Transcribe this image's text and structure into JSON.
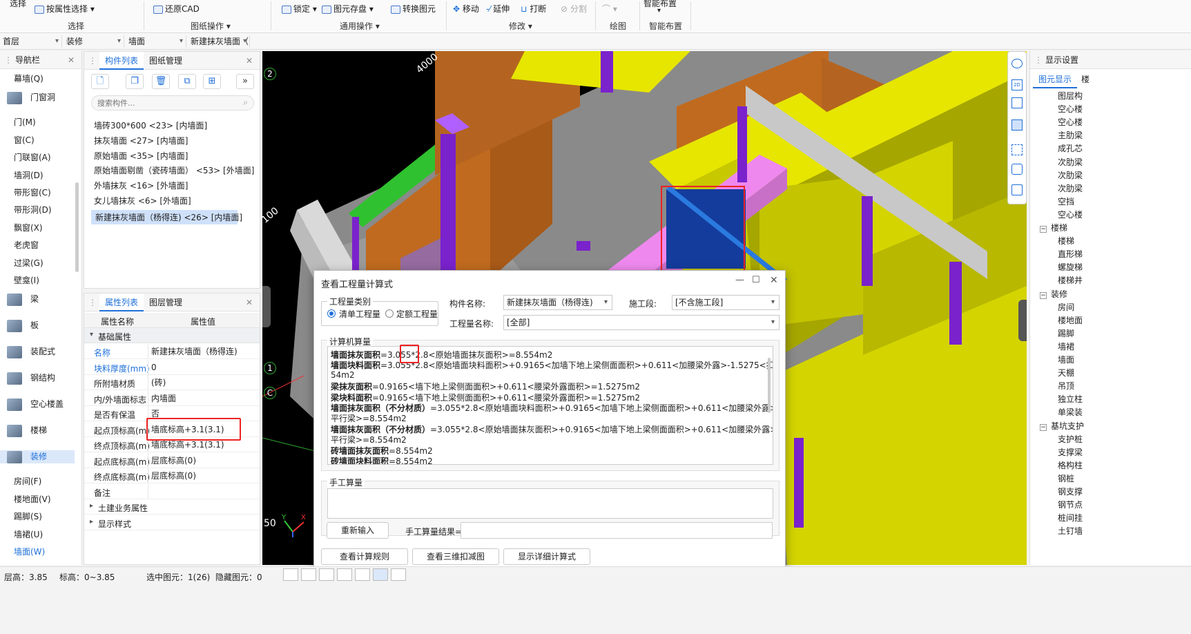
{
  "ribbon": {
    "select_label": "选择",
    "attr_select": "按属性选择",
    "select_group": "选择",
    "restore_cad": "还原CAD",
    "drawing_ops": "图纸操作",
    "lock": "锁定",
    "elem_save": "图元存盘",
    "convert_elem": "转换图元",
    "common_ops": "通用操作",
    "move": "移动",
    "extend": "延伸",
    "break": "打断",
    "split": "分割",
    "modify": "修改",
    "draw": "绘图",
    "smart_layout_top": "智能布置",
    "smart_layout": "智能布置"
  },
  "selectors": [
    "首层",
    "装修",
    "墙面",
    "新建抹灰墙面（"
  ],
  "nav": {
    "title": "导航栏",
    "items": [
      {
        "label": "幕墙(Q)",
        "type": "small"
      },
      {
        "label": "门窗洞",
        "type": "big"
      },
      {
        "label": "门(M)",
        "type": "small"
      },
      {
        "label": "窗(C)",
        "type": "small"
      },
      {
        "label": "门联窗(A)",
        "type": "small"
      },
      {
        "label": "墙洞(D)",
        "type": "small"
      },
      {
        "label": "带形窗(C)",
        "type": "small"
      },
      {
        "label": "带形洞(D)",
        "type": "small"
      },
      {
        "label": "飘窗(X)",
        "type": "small"
      },
      {
        "label": "老虎窗",
        "type": "small"
      },
      {
        "label": "过梁(G)",
        "type": "small"
      },
      {
        "label": "壁龛(I)",
        "type": "small"
      },
      {
        "label": "梁",
        "type": "big"
      },
      {
        "label": "板",
        "type": "big"
      },
      {
        "label": "装配式",
        "type": "big"
      },
      {
        "label": "钢结构",
        "type": "big"
      },
      {
        "label": "空心楼盖",
        "type": "big"
      },
      {
        "label": "楼梯",
        "type": "big"
      },
      {
        "label": "装修",
        "type": "big"
      },
      {
        "label": "房间(F)",
        "type": "small"
      },
      {
        "label": "楼地面(V)",
        "type": "small"
      },
      {
        "label": "踢脚(S)",
        "type": "small"
      },
      {
        "label": "墙裙(U)",
        "type": "small"
      },
      {
        "label": "墙面(W)",
        "type": "small"
      }
    ]
  },
  "complist": {
    "tab_active": "构件列表",
    "tab_other": "图纸管理",
    "search_placeholder": "搜索构件...",
    "items": [
      "墙砖300*600 <23> [内墙面]",
      "抹灰墙面 <27> [内墙面]",
      "原始墙面 <35> [内墙面]",
      "原始墙面剔凿（瓷砖墙面） <53> [外墙面]",
      "外墙抹灰 <16> [外墙面]",
      "女儿墙抹灰 <6> [外墙面]",
      "新建抹灰墙面（杨得连) <26> [内墙面]"
    ]
  },
  "props": {
    "tab_active": "属性列表",
    "tab_other": "图层管理",
    "col_name": "属性名称",
    "col_value": "属性值",
    "section_basic": "基础属性",
    "rows": [
      {
        "name": "名称",
        "value": "新建抹灰墙面（杨得连)",
        "blue": true
      },
      {
        "name": "块料厚度(mm)",
        "value": "0",
        "blue": true
      },
      {
        "name": "所附墙材质",
        "value": "(砖)",
        "blue": false
      },
      {
        "name": "内/外墙面标志",
        "value": "内墙面",
        "blue": false
      },
      {
        "name": "是否有保温",
        "value": "否",
        "blue": false
      },
      {
        "name": "起点顶标高(m)",
        "value": "墙底标高+3.1(3.1)",
        "blue": false
      },
      {
        "name": "终点顶标高(m)",
        "value": "墙底标高+3.1(3.1)",
        "blue": false
      },
      {
        "name": "起点底标高(m)",
        "value": "层底标高(0)",
        "blue": false
      },
      {
        "name": "终点底标高(m)",
        "value": "层底标高(0)",
        "blue": false
      },
      {
        "name": "备注",
        "value": "",
        "blue": false
      }
    ],
    "section_civil": "土建业务属性",
    "section_display": "显示样式"
  },
  "viewport": {
    "dim_4000": "4000",
    "dim_100": "100",
    "dim_50": "50",
    "axis_2": "2",
    "axis_1": "1",
    "axis_c": "C",
    "triad_y": "Y",
    "triad_x": "X"
  },
  "dialog": {
    "title": "查看工程量计算式",
    "qty_type_label": "工程量类别",
    "radio_bill": "清单工程量",
    "radio_quota": "定额工程量",
    "comp_name_label": "构件名称:",
    "comp_name_value": "新建抹灰墙面（杨得连)",
    "stage_label": "施工段:",
    "stage_value": "[不含施工段]",
    "qty_name_label": "工程量名称:",
    "qty_name_value": "[全部]",
    "calc_label": "计算机算量",
    "formulas": [
      {
        "k": "墙面抹灰面积",
        "v": "=3.055*2.8<原始墙面抹灰面积>=8.554m2"
      },
      {
        "k": "墙面块料面积",
        "v": "=3.055*2.8<原始墙面块料面积>+0.9165<加墙下地上梁侧面面积>+0.611<加腰梁外露>-1.5275<扣平行梁>=8.5"
      },
      {
        "k": "",
        "v": "54m2"
      },
      {
        "k": "梁抹灰面积",
        "v": "=0.9165<墙下地上梁侧面面积>+0.611<腰梁外露面积>=1.5275m2"
      },
      {
        "k": "梁块料面积",
        "v": "=0.9165<墙下地上梁侧面面积>+0.611<腰梁外露面积>=1.5275m2"
      },
      {
        "k": "墙面抹灰面积（不分材质）",
        "v": "=3.055*2.8<原始墙面块料面积>+0.9165<加墙下地上梁侧面面积>+0.611<加腰梁外露>-1.5275<扣"
      },
      {
        "k": "",
        "v": "平行梁>=8.554m2"
      },
      {
        "k": "墙面抹灰面积（不分材质）",
        "v": "=3.055*2.8<原始墙面抹灰面积>+0.9165<加墙下地上梁侧面面积>+0.611<加腰梁外露>-1.5275<扣"
      },
      {
        "k": "",
        "v": "平行梁>=8.554m2"
      },
      {
        "k": "砖墙面抹灰面积",
        "v": "=8.554m2"
      },
      {
        "k": "砖墙面块料面积",
        "v": "=8.554m2"
      }
    ],
    "manual_label": "手工算量",
    "reenter": "重新输入",
    "manual_result": "手工算量结果=",
    "btn_rules": "查看计算规则",
    "btn_3d": "查看三维扣减图",
    "btn_detail": "显示详细计算式"
  },
  "rpanel": {
    "title": "显示设置",
    "tab_active": "图元显示",
    "tab_other": "楼",
    "items": [
      {
        "label": "图层构",
        "kind": "item"
      },
      {
        "label": "空心楼",
        "kind": "item"
      },
      {
        "label": "空心楼",
        "kind": "item"
      },
      {
        "label": "主肋梁",
        "kind": "item"
      },
      {
        "label": "成孔芯",
        "kind": "item"
      },
      {
        "label": "次肋梁",
        "kind": "item"
      },
      {
        "label": "次肋梁",
        "kind": "item"
      },
      {
        "label": "次肋梁",
        "kind": "item"
      },
      {
        "label": "空挡",
        "kind": "item"
      },
      {
        "label": "空心楼",
        "kind": "item"
      },
      {
        "label": "楼梯",
        "kind": "group"
      },
      {
        "label": "楼梯",
        "kind": "item"
      },
      {
        "label": "直形梯",
        "kind": "item"
      },
      {
        "label": "螺旋梯",
        "kind": "item"
      },
      {
        "label": "楼梯井",
        "kind": "item"
      },
      {
        "label": "装修",
        "kind": "group"
      },
      {
        "label": "房间",
        "kind": "item"
      },
      {
        "label": "楼地面",
        "kind": "item"
      },
      {
        "label": "踢脚",
        "kind": "item"
      },
      {
        "label": "墙裙",
        "kind": "item"
      },
      {
        "label": "墙面",
        "kind": "item"
      },
      {
        "label": "天棚",
        "kind": "item"
      },
      {
        "label": "吊顶",
        "kind": "item"
      },
      {
        "label": "独立柱",
        "kind": "item"
      },
      {
        "label": "单梁装",
        "kind": "item"
      },
      {
        "label": "基坑支护",
        "kind": "group"
      },
      {
        "label": "支护桩",
        "kind": "item"
      },
      {
        "label": "支撑梁",
        "kind": "item"
      },
      {
        "label": "格构柱",
        "kind": "item"
      },
      {
        "label": "钢桩",
        "kind": "item"
      },
      {
        "label": "钢支撑",
        "kind": "item"
      },
      {
        "label": "钢节点",
        "kind": "item"
      },
      {
        "label": "桩间挂",
        "kind": "item"
      },
      {
        "label": "土钉墙",
        "kind": "item"
      }
    ]
  },
  "status": {
    "floor_h": "层高：3.85",
    "elev": "标高：0~3.85",
    "selected": "选中图元：1(26)",
    "hidden": "隐藏图元：0"
  }
}
